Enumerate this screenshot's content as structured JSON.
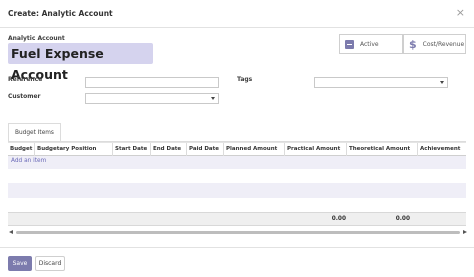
{
  "dialog": {
    "title": "Create: Analytic Account",
    "close_glyph": "×"
  },
  "form": {
    "name_label": "Analytic Account",
    "name_value": "Fuel Expense Account",
    "reference_label": "Reference",
    "reference_value": "",
    "customer_label": "Customer",
    "customer_value": "",
    "tags_label": "Tags",
    "tags_value": ""
  },
  "smart_buttons": {
    "active_label": "Active",
    "active_icon": "archive-icon",
    "cost_revenue_label": "Cost/Revenue",
    "cost_revenue_icon": "dollar-icon"
  },
  "tabs": [
    {
      "label": "Budget Items",
      "active": true
    }
  ],
  "budget_table": {
    "columns": [
      "Budget",
      "Budgetary Position",
      "Start Date",
      "End Date",
      "Paid Date",
      "Planned Amount",
      "Practical Amount",
      "Theoretical Amount",
      "Achievement"
    ],
    "add_item_label": "Add an item",
    "totals": {
      "practical": "0.00",
      "theoretical": "0.00"
    }
  },
  "footer": {
    "save_label": "Save",
    "discard_label": "Discard"
  },
  "colors": {
    "primary": "#7c7bad",
    "name_highlight": "#d5d3ee",
    "row_stripe": "#efeef7"
  }
}
